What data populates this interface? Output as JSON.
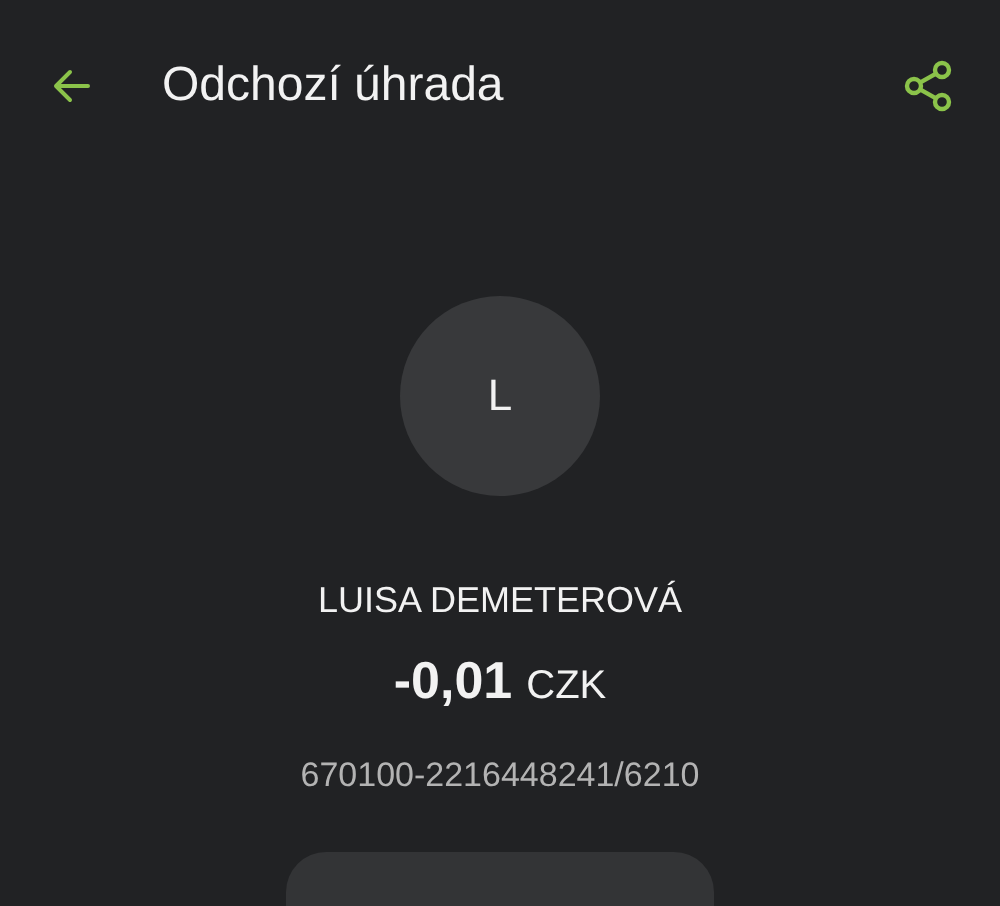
{
  "header": {
    "title": "Odchozí úhrada"
  },
  "counterparty": {
    "initial": "L",
    "name": "LUISA DEMETEROVÁ",
    "amount": "-0,01",
    "currency": "CZK",
    "account": "670100-2216448241/6210"
  }
}
